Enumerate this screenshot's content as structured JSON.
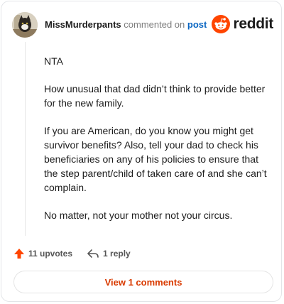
{
  "comment": {
    "username": "MissMurderpants",
    "commented_text": "commented on",
    "post_link": "post",
    "paragraphs": [
      "NTA",
      "How unusual that dad didn’t think to provide better for the new family.",
      "If you are American, do you know you might get survivor benefits? Also, tell your dad to check his beneficiaries on any of his policies to ensure that the step parent/child of taken care of and she can’t complain.",
      "No matter, not your mother not your circus."
    ]
  },
  "brand": {
    "name": "reddit",
    "color": "#ff4500"
  },
  "actions": {
    "upvotes": "11 upvotes",
    "replies": "1 reply"
  },
  "view_comments_label": "View 1 comments",
  "colors": {
    "accent": "#d93a00",
    "link": "#0a66c2",
    "upvote": "#ff4500"
  }
}
